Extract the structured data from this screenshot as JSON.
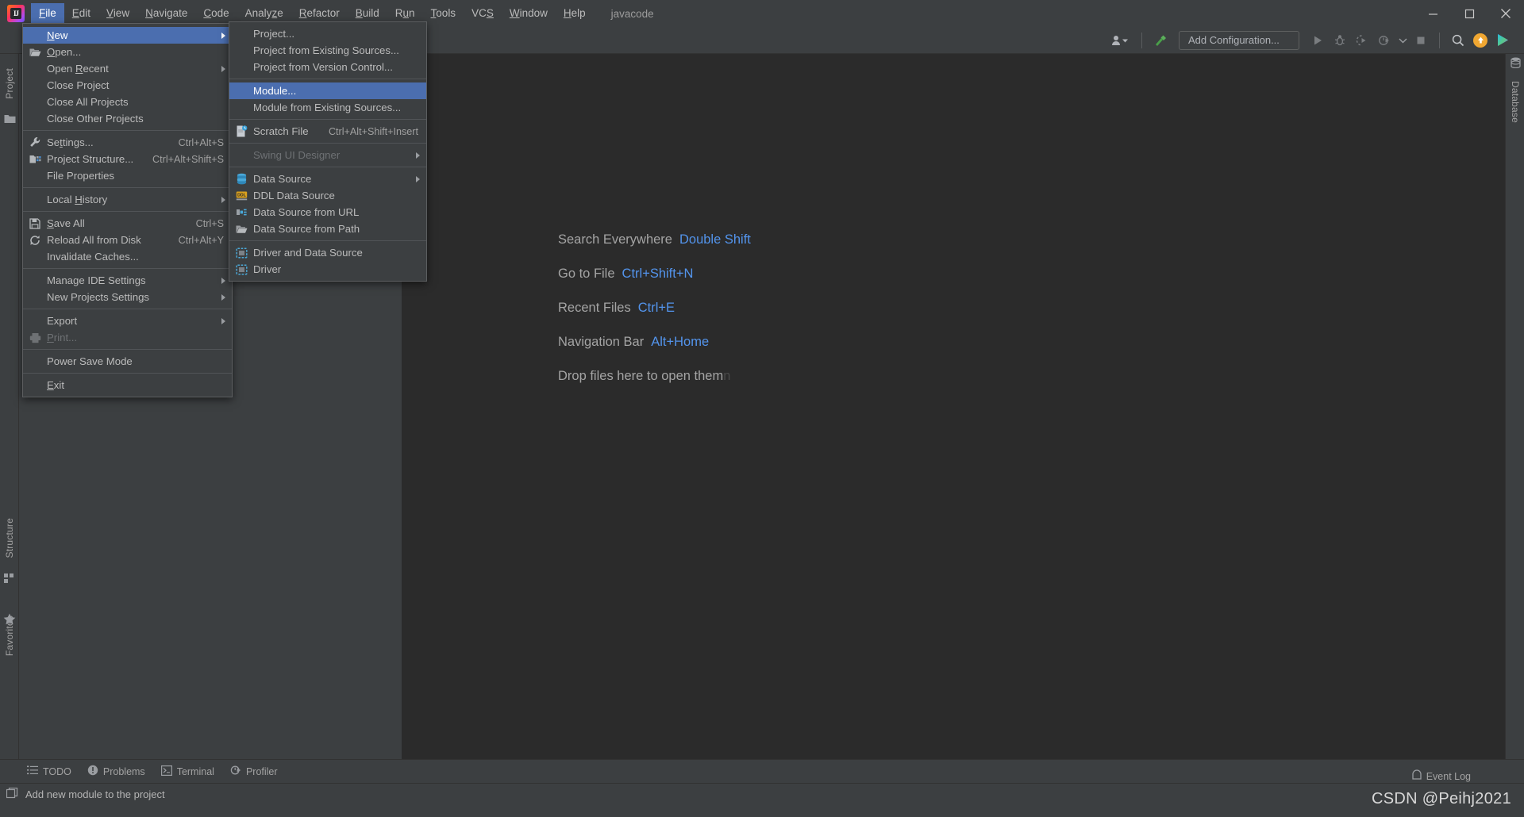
{
  "window": {
    "project_name": "javacode",
    "logo_text": "IJ",
    "controls": [
      {
        "name": "minimize-button",
        "glyph": "minimize"
      },
      {
        "name": "maximize-button",
        "glyph": "maximize"
      },
      {
        "name": "close-button",
        "glyph": "close"
      }
    ]
  },
  "menubar": {
    "items": [
      {
        "label": "File",
        "mnemonic": "F",
        "active": true
      },
      {
        "label": "Edit",
        "mnemonic": "E",
        "active": false
      },
      {
        "label": "View",
        "mnemonic": "V",
        "active": false
      },
      {
        "label": "Navigate",
        "mnemonic": "N",
        "active": false
      },
      {
        "label": "Code",
        "mnemonic": "C",
        "active": false
      },
      {
        "label": "Analyze",
        "mnemonic": "z",
        "active": false
      },
      {
        "label": "Refactor",
        "mnemonic": "R",
        "active": false
      },
      {
        "label": "Build",
        "mnemonic": "B",
        "active": false
      },
      {
        "label": "Run",
        "mnemonic": "u",
        "active": false
      },
      {
        "label": "Tools",
        "mnemonic": "T",
        "active": false
      },
      {
        "label": "VCS",
        "mnemonic": "S",
        "active": false
      },
      {
        "label": "Window",
        "mnemonic": "W",
        "active": false
      },
      {
        "label": "Help",
        "mnemonic": "H",
        "active": false
      }
    ]
  },
  "toolbar": {
    "add_configuration_label": "Add Configuration...",
    "buttons": [
      {
        "name": "user-accounts-icon",
        "label": "Accounts"
      },
      {
        "name": "build-hammer-icon",
        "label": "Build"
      },
      {
        "name": "run-icon",
        "label": "Run"
      },
      {
        "name": "debug-icon",
        "label": "Debug"
      },
      {
        "name": "run-with-coverage-icon",
        "label": "Run with Coverage"
      },
      {
        "name": "profiler-icon",
        "label": "Profile"
      },
      {
        "name": "stop-icon",
        "label": "Stop"
      },
      {
        "name": "search-everywhere-icon",
        "label": "Search Everywhere"
      },
      {
        "name": "updates-available-icon",
        "label": "Updates"
      },
      {
        "name": "ide-assistant-icon",
        "label": "Assistant"
      }
    ]
  },
  "file_menu": {
    "groups": [
      [
        {
          "label": "New",
          "mnemonic": "N",
          "icon": null,
          "shortcut": "",
          "submenu": true,
          "selected": true,
          "disabled": false
        },
        {
          "label": "Open...",
          "mnemonic": "O",
          "icon": "folder-open-icon",
          "shortcut": "",
          "submenu": false,
          "selected": false,
          "disabled": false
        },
        {
          "label": "Open Recent",
          "mnemonic": "R",
          "icon": null,
          "shortcut": "",
          "submenu": true,
          "selected": false,
          "disabled": false
        },
        {
          "label": "Close Project",
          "mnemonic": "",
          "icon": null,
          "shortcut": "",
          "submenu": false,
          "selected": false,
          "disabled": false
        },
        {
          "label": "Close All Projects",
          "mnemonic": "",
          "icon": null,
          "shortcut": "",
          "submenu": false,
          "selected": false,
          "disabled": false
        },
        {
          "label": "Close Other Projects",
          "mnemonic": "",
          "icon": null,
          "shortcut": "",
          "submenu": false,
          "selected": false,
          "disabled": false
        }
      ],
      [
        {
          "label": "Settings...",
          "mnemonic": "t",
          "icon": "wrench-icon",
          "shortcut": "Ctrl+Alt+S",
          "submenu": false,
          "selected": false,
          "disabled": false
        },
        {
          "label": "Project Structure...",
          "mnemonic": "",
          "icon": "project-structure-icon",
          "shortcut": "Ctrl+Alt+Shift+S",
          "submenu": false,
          "selected": false,
          "disabled": false
        },
        {
          "label": "File Properties",
          "mnemonic": "",
          "icon": null,
          "shortcut": "",
          "submenu": false,
          "selected": false,
          "disabled": false
        }
      ],
      [
        {
          "label": "Local History",
          "mnemonic": "H",
          "icon": null,
          "shortcut": "",
          "submenu": true,
          "selected": false,
          "disabled": false
        }
      ],
      [
        {
          "label": "Save All",
          "mnemonic": "S",
          "icon": "save-icon",
          "shortcut": "Ctrl+S",
          "submenu": false,
          "selected": false,
          "disabled": false
        },
        {
          "label": "Reload All from Disk",
          "mnemonic": "",
          "icon": "reload-icon",
          "shortcut": "Ctrl+Alt+Y",
          "submenu": false,
          "selected": false,
          "disabled": false
        },
        {
          "label": "Invalidate Caches...",
          "mnemonic": "",
          "icon": null,
          "shortcut": "",
          "submenu": false,
          "selected": false,
          "disabled": false
        }
      ],
      [
        {
          "label": "Manage IDE Settings",
          "mnemonic": "",
          "icon": null,
          "shortcut": "",
          "submenu": true,
          "selected": false,
          "disabled": false
        },
        {
          "label": "New Projects Settings",
          "mnemonic": "",
          "icon": null,
          "shortcut": "",
          "submenu": true,
          "selected": false,
          "disabled": false
        }
      ],
      [
        {
          "label": "Export",
          "mnemonic": "",
          "icon": null,
          "shortcut": "",
          "submenu": true,
          "selected": false,
          "disabled": false
        },
        {
          "label": "Print...",
          "mnemonic": "P",
          "icon": "printer-icon",
          "shortcut": "",
          "submenu": false,
          "selected": false,
          "disabled": true
        }
      ],
      [
        {
          "label": "Power Save Mode",
          "mnemonic": "",
          "icon": null,
          "shortcut": "",
          "submenu": false,
          "selected": false,
          "disabled": false
        }
      ],
      [
        {
          "label": "Exit",
          "mnemonic": "E",
          "icon": null,
          "shortcut": "",
          "submenu": false,
          "selected": false,
          "disabled": false
        }
      ]
    ]
  },
  "new_menu": {
    "groups": [
      [
        {
          "label": "Project...",
          "icon": null,
          "shortcut": "",
          "selected": false,
          "disabled": false,
          "submenu": false
        },
        {
          "label": "Project from Existing Sources...",
          "icon": null,
          "shortcut": "",
          "selected": false,
          "disabled": false,
          "submenu": false
        },
        {
          "label": "Project from Version Control...",
          "icon": null,
          "shortcut": "",
          "selected": false,
          "disabled": false,
          "submenu": false
        }
      ],
      [
        {
          "label": "Module...",
          "icon": null,
          "shortcut": "",
          "selected": true,
          "disabled": false,
          "submenu": false
        },
        {
          "label": "Module from Existing Sources...",
          "icon": null,
          "shortcut": "",
          "selected": false,
          "disabled": false,
          "submenu": false
        }
      ],
      [
        {
          "label": "Scratch File",
          "icon": "scratch-file-icon",
          "shortcut": "Ctrl+Alt+Shift+Insert",
          "selected": false,
          "disabled": false,
          "submenu": false
        }
      ],
      [
        {
          "label": "Swing UI Designer",
          "icon": null,
          "shortcut": "",
          "selected": false,
          "disabled": true,
          "submenu": true
        }
      ],
      [
        {
          "label": "Data Source",
          "icon": "database-icon",
          "shortcut": "",
          "selected": false,
          "disabled": false,
          "submenu": true
        },
        {
          "label": "DDL Data Source",
          "icon": "ddl-icon",
          "shortcut": "",
          "selected": false,
          "disabled": false,
          "submenu": false
        },
        {
          "label": "Data Source from URL",
          "icon": "data-source-url-icon",
          "shortcut": "",
          "selected": false,
          "disabled": false,
          "submenu": false
        },
        {
          "label": "Data Source from Path",
          "icon": "folder-open-icon",
          "shortcut": "",
          "selected": false,
          "disabled": false,
          "submenu": false
        }
      ],
      [
        {
          "label": "Driver and Data Source",
          "icon": "driver-icon",
          "shortcut": "",
          "selected": false,
          "disabled": false,
          "submenu": false
        },
        {
          "label": "Driver",
          "icon": "driver-icon",
          "shortcut": "",
          "selected": false,
          "disabled": false,
          "submenu": false
        }
      ]
    ]
  },
  "left_stripe": {
    "items": [
      {
        "label": "Project",
        "name": "tool-window-project"
      },
      {
        "label": "Structure",
        "name": "tool-window-structure"
      },
      {
        "label": "Favorites",
        "name": "tool-window-favorites"
      }
    ]
  },
  "right_stripe": {
    "items": [
      {
        "label": "Database",
        "name": "tool-window-database"
      }
    ]
  },
  "editor": {
    "welcome_rows": [
      {
        "action": "Search Everywhere",
        "shortcut": "Double Shift"
      },
      {
        "action": "Go to File",
        "shortcut": "Ctrl+Shift+N"
      },
      {
        "action": "Recent Files",
        "shortcut": "Ctrl+E"
      },
      {
        "action": "Navigation Bar",
        "shortcut": "Alt+Home"
      }
    ],
    "drop_hint": "Drop files here to open them",
    "drop_hint_tail": "n"
  },
  "bottom_bar": {
    "items": [
      {
        "label": "TODO",
        "icon": "todo-list-icon"
      },
      {
        "label": "Problems",
        "icon": "problems-icon"
      },
      {
        "label": "Terminal",
        "icon": "terminal-icon"
      },
      {
        "label": "Profiler",
        "icon": "profiler-icon"
      }
    ]
  },
  "statusbar": {
    "message": "Add new module to the project",
    "message_icon": "module-icon",
    "event_log_label": "Event Log",
    "watermark": "CSDN @Peihj2021"
  },
  "colors": {
    "accent_selection": "#4b6eaf",
    "panel_bg": "#3c3f41",
    "editor_bg": "#2b2b2b",
    "link_blue": "#5394ec",
    "text": "#bbbbbb"
  }
}
